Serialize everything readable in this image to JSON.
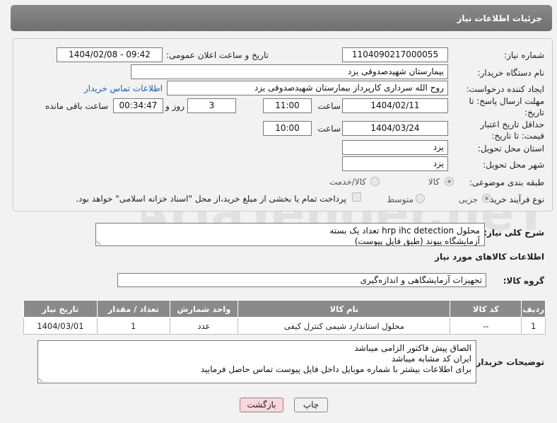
{
  "page": {
    "title": "جزئیات اطلاعات نیاز"
  },
  "form": {
    "need_number_label": "شماره نیاز:",
    "need_number": "1104090217000055",
    "announce_label": "تاریخ و ساعت اعلان عمومی:",
    "announce_value": "1404/02/08 - 09:42",
    "buyer_org_label": "نام دستگاه خریدار:",
    "buyer_org": "بیمارستان شهیدصدوقی یزد",
    "creator_label": "ایجاد کننده درخواست:",
    "creator": "روح الله سرداری کارپرداز بیمارستان شهیدصدوقی یزد",
    "buyer_contact_link": "اطلاعات تماس خریدار",
    "deadline_label": "مهلت ارسال پاسخ: تا تاریخ:",
    "deadline_date": "1404/02/11",
    "time_label": "ساعت",
    "deadline_time": "11:00",
    "days": "3",
    "days_label": "روز و",
    "remaining_time": "00:34:47",
    "remaining_label": "ساعت باقی مانده",
    "price_validity_label": "حداقل تاریخ اعتبار قیمت: تا تاریخ:",
    "price_validity_date": "1404/03/24",
    "price_validity_time": "10:00",
    "province_label": "استان محل تحویل:",
    "province": "یزد",
    "city_label": "شهر محل تحویل:",
    "city": "یزد",
    "category_label": "طبقه بندی موضوعی:",
    "category_options": [
      "کالا",
      "کالا/خدمت"
    ],
    "process_label": "نوع فرآیند خرید :",
    "process_options": [
      "جزیی",
      "متوسط"
    ],
    "payment_note": "پرداخت تمام یا بخشی از مبلغ خرید،از محل \"اسناد خزانه اسلامی\" خواهد بود."
  },
  "description": {
    "label": "شرح کلی نیاز:",
    "line1": "محلول hrp ihc detection  تعداد یک بسته",
    "line2": "آزمایشگاه پیوند (طبق فایل پیوست)"
  },
  "goods": {
    "section_title": "اطلاعات کالاهای مورد نیاز",
    "group_label": "گروه کالا:",
    "group_value": "تجهیزات آزمایشگاهی و اندازه‌گیری",
    "headers": [
      "ردیف",
      "کد کالا",
      "نام کالا",
      "واحد شمارش",
      "تعداد / مقدار",
      "تاریخ نیاز"
    ],
    "rows": [
      [
        "1",
        "--",
        "محلول استاندارد شیمی کنترل کیفی",
        "عدد",
        "1",
        "1404/03/01"
      ]
    ]
  },
  "buyer_notes": {
    "label": "توضیحات خریدار:",
    "line1": "الصاق پیش فاکتور الزامی میباشد",
    "line2": "ایران کد مشابه میباشد",
    "line3": "برای اطلاعات بیشتر با شماره موبایل داخل فایل پیوست تماس حاصل فرمایید"
  },
  "buttons": {
    "print": "چاپ",
    "back": "بازگشت"
  },
  "watermark": {
    "text": "AriaTender.neT"
  },
  "colors": {
    "header_bg": "#7d7d7d",
    "link": "#1a5fb4",
    "back_button_bg": "#f9d7dc"
  }
}
